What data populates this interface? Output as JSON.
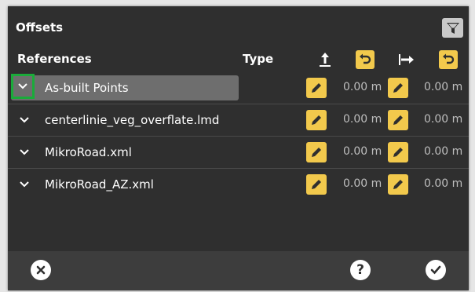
{
  "dialog": {
    "title": "Offsets",
    "columns": {
      "references": "References",
      "type": "Type"
    },
    "rows": [
      {
        "label": "As-built Points",
        "value1": "0.00 m",
        "value2": "0.00 m",
        "selected": true
      },
      {
        "label": "centerlinie_veg_overflate.lmd",
        "value1": "0.00 m",
        "value2": "0.00 m",
        "selected": false
      },
      {
        "label": "MikroRoad.xml",
        "value1": "0.00 m",
        "value2": "0.00 m",
        "selected": false
      },
      {
        "label": "MikroRoad_AZ.xml",
        "value1": "0.00 m",
        "value2": "0.00 m",
        "selected": false
      }
    ],
    "footer": {
      "help_label": "?"
    },
    "colors": {
      "background": "#2f2f2f",
      "accent_yellow": "#f2c94c",
      "focus_green": "#1aab3a",
      "selection": "#6e6e6e"
    },
    "icons": [
      "filter-icon",
      "vertical-offset-icon",
      "reset-icon",
      "horizontal-offset-icon",
      "chevron-down-icon",
      "pencil-icon",
      "close-icon",
      "help-icon",
      "checkmark-icon"
    ]
  }
}
